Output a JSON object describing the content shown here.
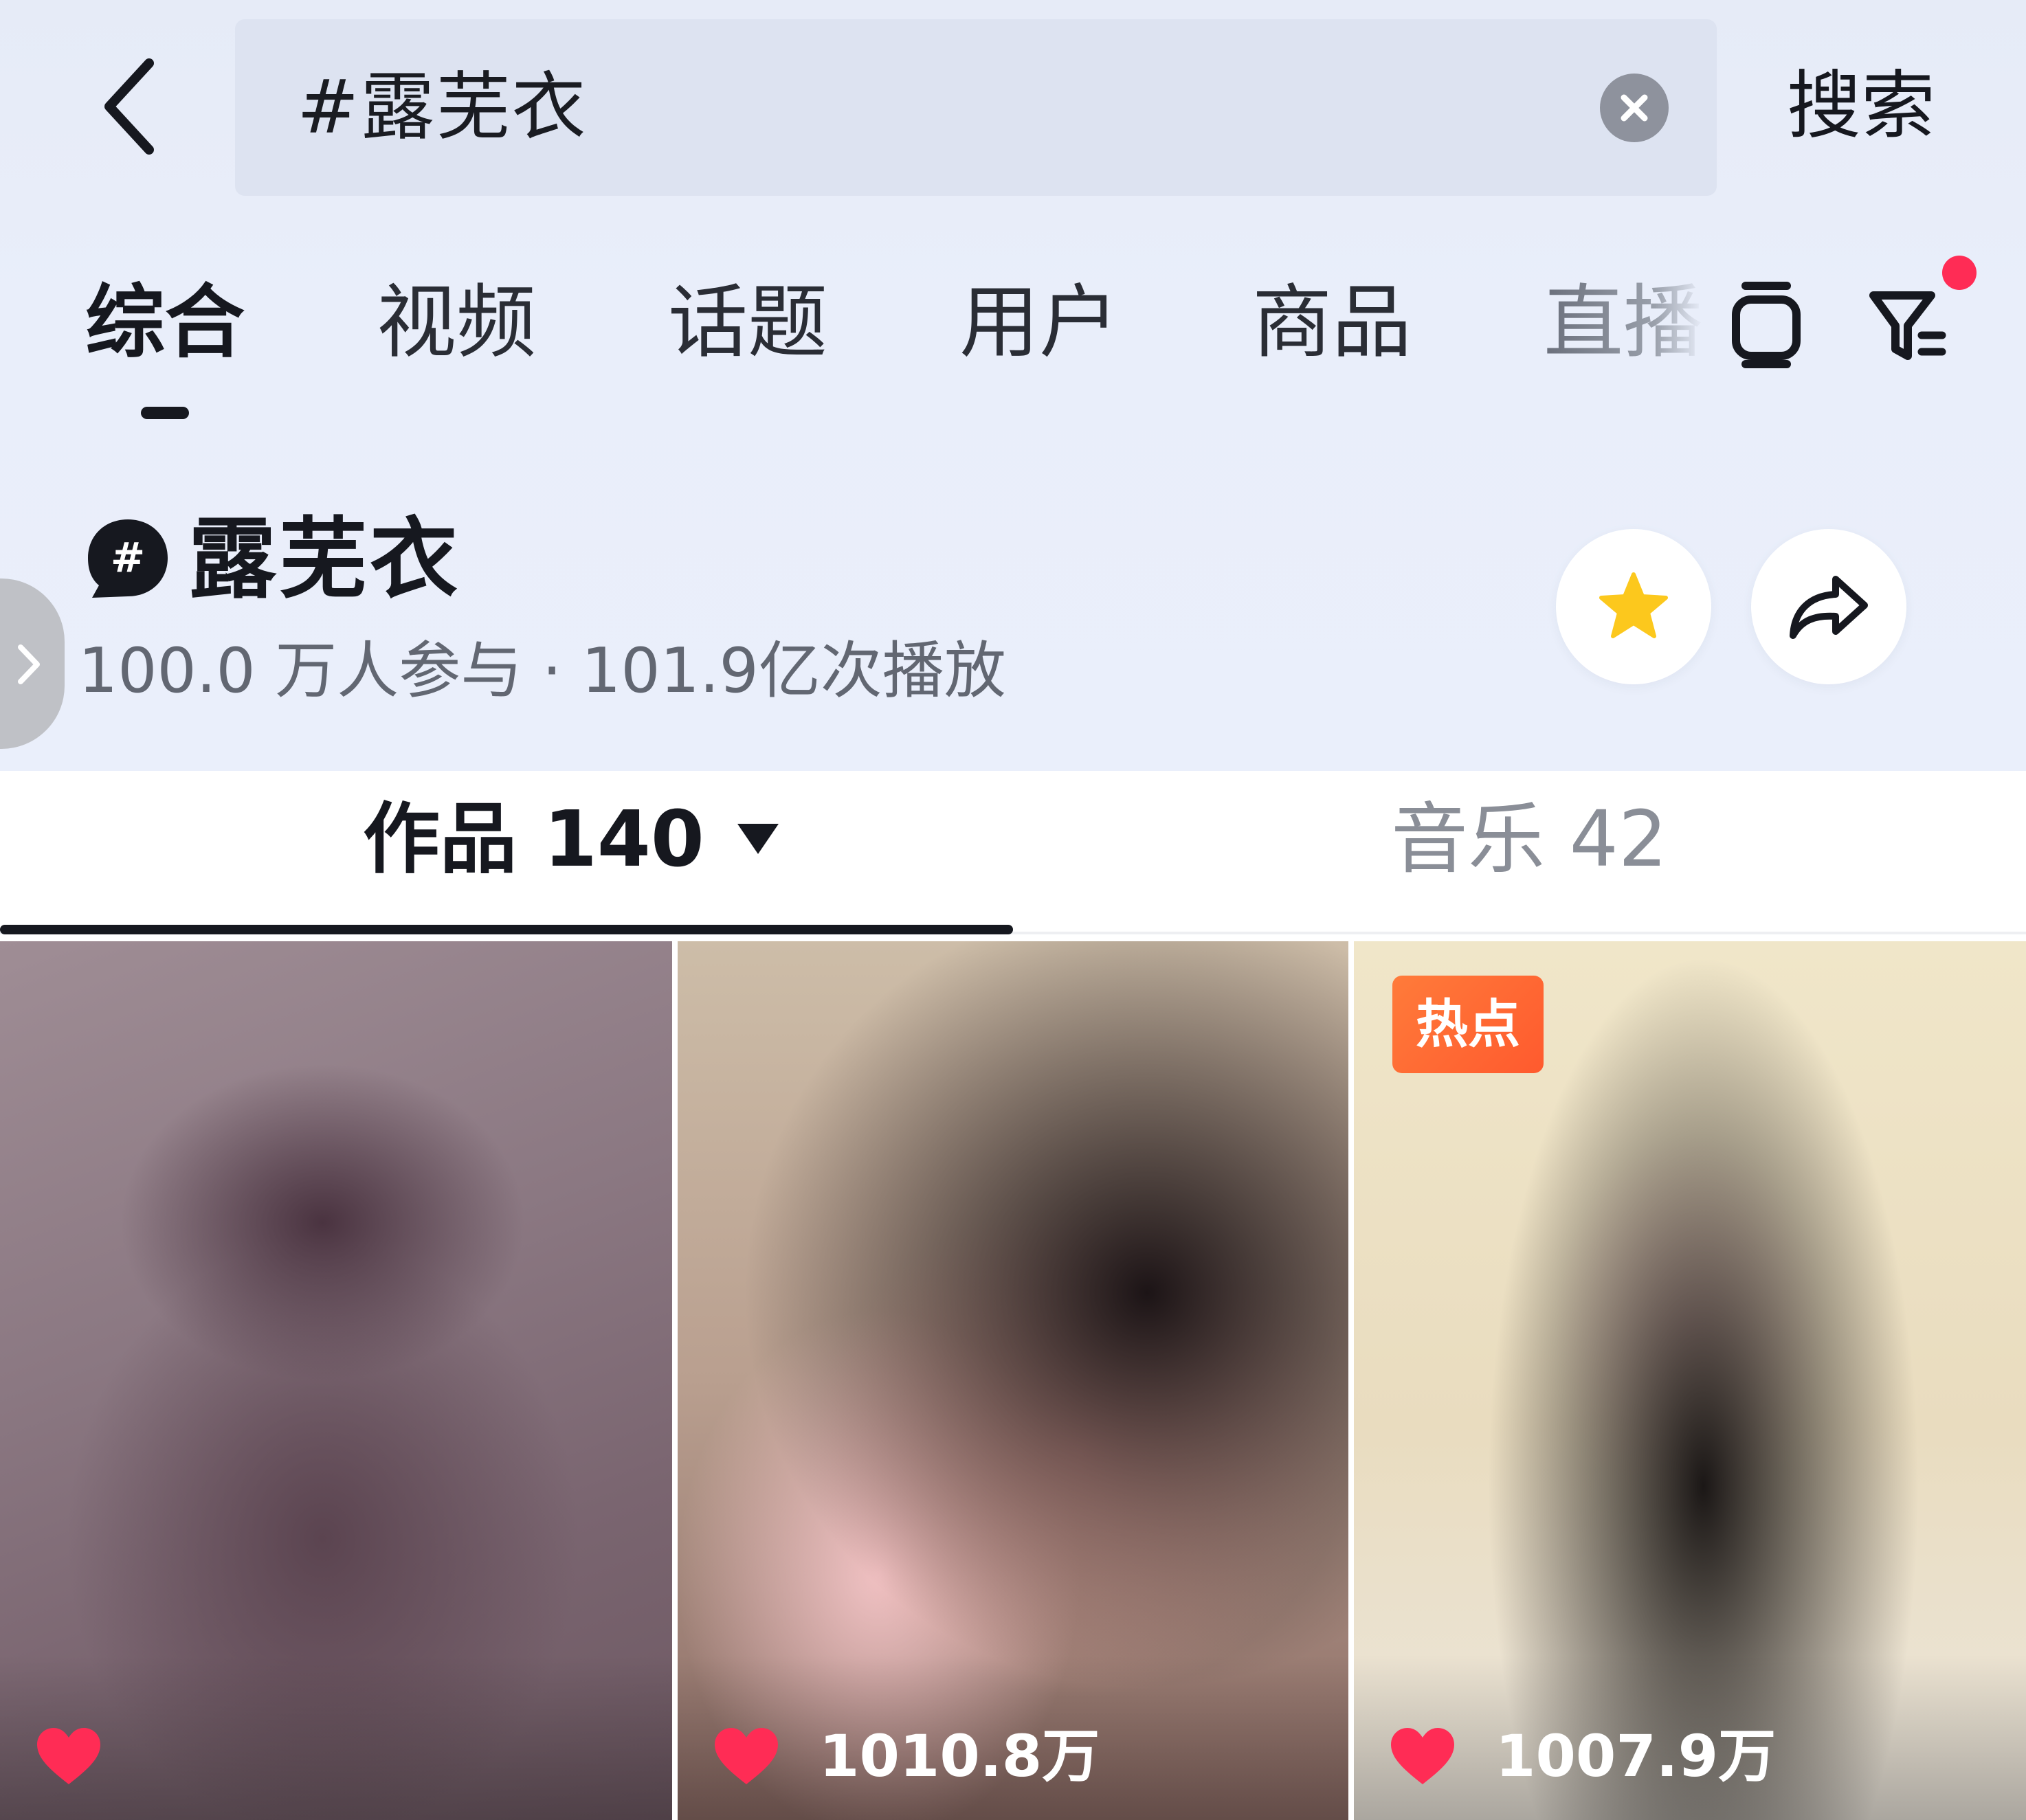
{
  "search": {
    "query": "#露芜衣",
    "submit_label": "搜索"
  },
  "tabs": [
    {
      "label": "综合",
      "active": true
    },
    {
      "label": "视频"
    },
    {
      "label": "话题"
    },
    {
      "label": "用户"
    },
    {
      "label": "商品"
    },
    {
      "label": "直播"
    }
  ],
  "topic": {
    "title": "露芜衣",
    "stats": "100.0 万人参与 · 101.9亿次播放"
  },
  "content_tabs": {
    "works": "作品 140",
    "music": "音乐 42"
  },
  "videos": [
    {
      "likes": ""
    },
    {
      "likes": "1010.8万"
    },
    {
      "likes": "1007.9万",
      "badge": "热点"
    }
  ],
  "colors": {
    "accent_red": "#ff2c55",
    "star_yellow": "#fcc81d",
    "hot_badge": "#ff6a32"
  },
  "icons": [
    "back-arrow-icon",
    "clear-icon",
    "tv-icon",
    "filter-icon",
    "hashtag-bubble-icon",
    "star-icon",
    "share-icon",
    "chevron-right-icon",
    "heart-icon"
  ]
}
